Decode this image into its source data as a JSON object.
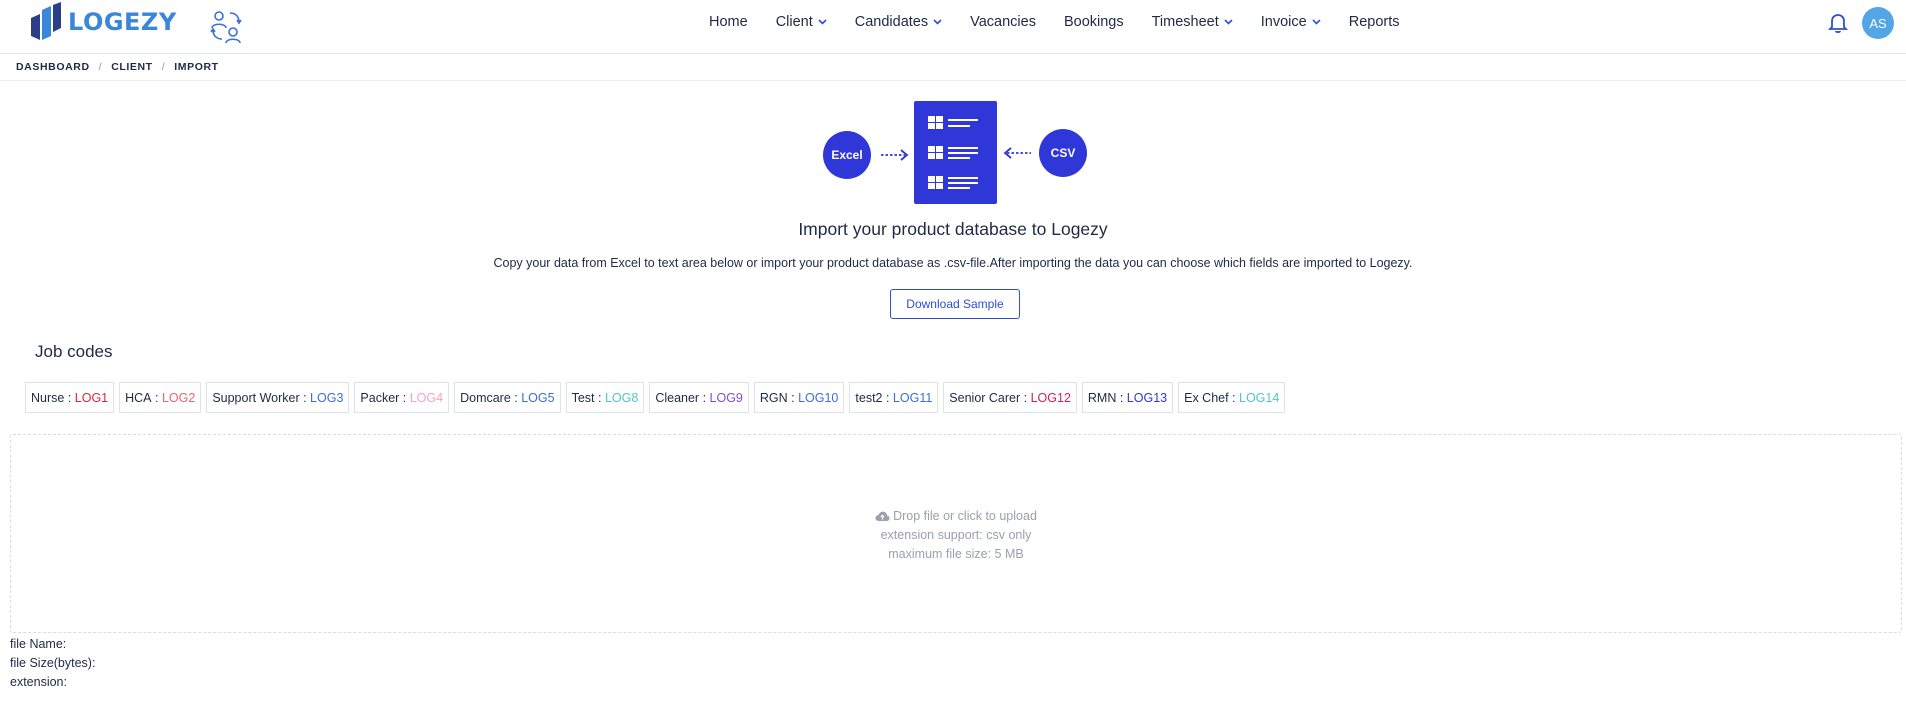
{
  "header": {
    "logo_text": "LOGEZY",
    "nav": [
      {
        "label": "Home",
        "dropdown": false
      },
      {
        "label": "Client",
        "dropdown": true
      },
      {
        "label": "Candidates",
        "dropdown": true
      },
      {
        "label": "Vacancies",
        "dropdown": false
      },
      {
        "label": "Bookings",
        "dropdown": false
      },
      {
        "label": "Timesheet",
        "dropdown": true
      },
      {
        "label": "Invoice",
        "dropdown": true
      },
      {
        "label": "Reports",
        "dropdown": false
      }
    ],
    "avatar_initials": "AS"
  },
  "breadcrumb": [
    "DASHBOARD",
    "CLIENT",
    "IMPORT"
  ],
  "illustration": {
    "left_label": "Excel",
    "right_label": "CSV"
  },
  "main": {
    "title": "Import your product database to Logezy",
    "description": "Copy your data from Excel to text area below or import your product database as .csv-file.After importing the data you can choose which fields are imported to Logezy.",
    "download_label": "Download Sample"
  },
  "job_codes": {
    "title": "Job codes",
    "items": [
      {
        "name": "Nurse",
        "code": "LOG1",
        "color": "#e0263c"
      },
      {
        "name": "HCA",
        "code": "LOG2",
        "color": "#e8646f"
      },
      {
        "name": "Support Worker",
        "code": "LOG3",
        "color": "#3a6fd8"
      },
      {
        "name": "Packer",
        "code": "LOG4",
        "color": "#f3a4c6"
      },
      {
        "name": "Domcare",
        "code": "LOG5",
        "color": "#3a6fd8"
      },
      {
        "name": "Test",
        "code": "LOG8",
        "color": "#4fc7c9"
      },
      {
        "name": "Cleaner",
        "code": "LOG9",
        "color": "#7b4fd6"
      },
      {
        "name": "RGN",
        "code": "LOG10",
        "color": "#3a6fd8"
      },
      {
        "name": "test2",
        "code": "LOG11",
        "color": "#3a6fd8"
      },
      {
        "name": "Senior Carer",
        "code": "LOG12",
        "color": "#d0215e"
      },
      {
        "name": "RMN",
        "code": "LOG13",
        "color": "#2f37d9"
      },
      {
        "name": "Ex Chef",
        "code": "LOG14",
        "color": "#4fc7c9"
      }
    ]
  },
  "dropzone": {
    "line1": "Drop file or click to upload",
    "line2": "extension support: csv only",
    "line3": "maximum file size: 5 MB"
  },
  "file_info": {
    "name_label": "file Name:",
    "size_label": "file Size(bytes):",
    "ext_label": "extension:"
  },
  "colors": {
    "brand": "#2f37d9",
    "logo": "#3a86d8",
    "avatar": "#53a6e6"
  }
}
